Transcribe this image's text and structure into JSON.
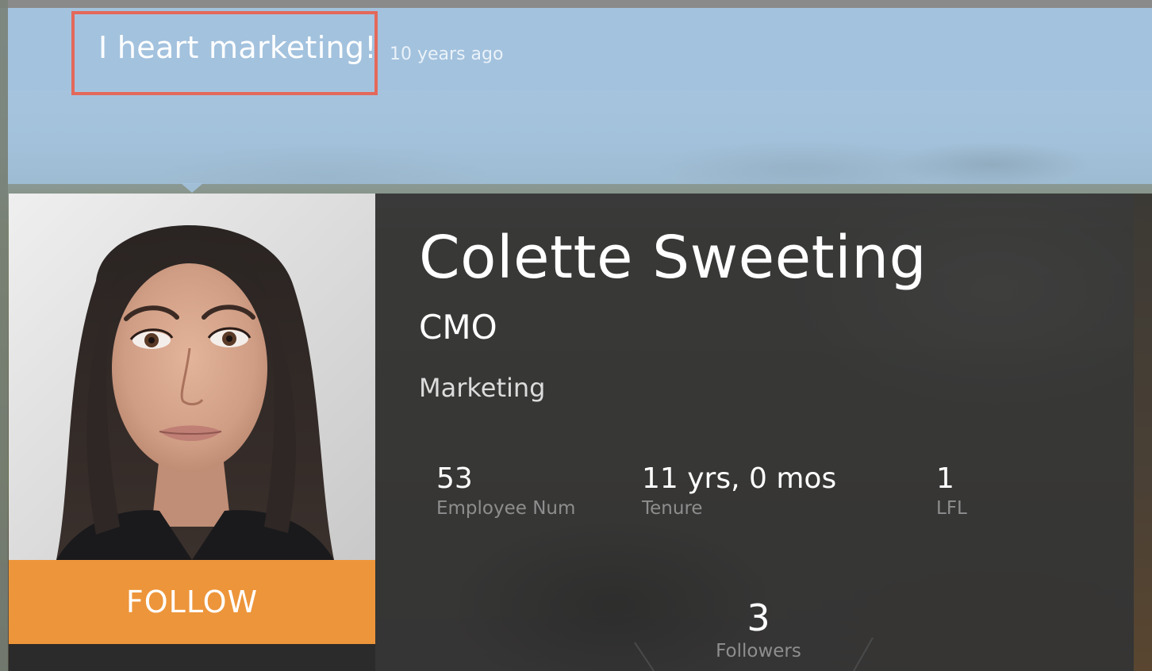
{
  "post": {
    "title": "I heart marketing!",
    "time": "10 years ago"
  },
  "profile": {
    "name": "Colette Sweeting",
    "job_title": "CMO",
    "department": "Marketing",
    "follow_label": "FOLLOW"
  },
  "stats": {
    "employee_num": {
      "value": "53",
      "label": "Employee Num"
    },
    "tenure": {
      "value": "11 yrs, 0 mos",
      "label": "Tenure"
    },
    "lfl": {
      "value": "1",
      "label": "LFL"
    },
    "followers": {
      "value": "3",
      "label": "Followers"
    }
  },
  "colors": {
    "header_bar": "#a3c2de",
    "highlight_border": "#e4685a",
    "follow_button": "#ed953a",
    "info_panel": "#343434"
  },
  "icons": {
    "avatar": "profile-photo"
  }
}
